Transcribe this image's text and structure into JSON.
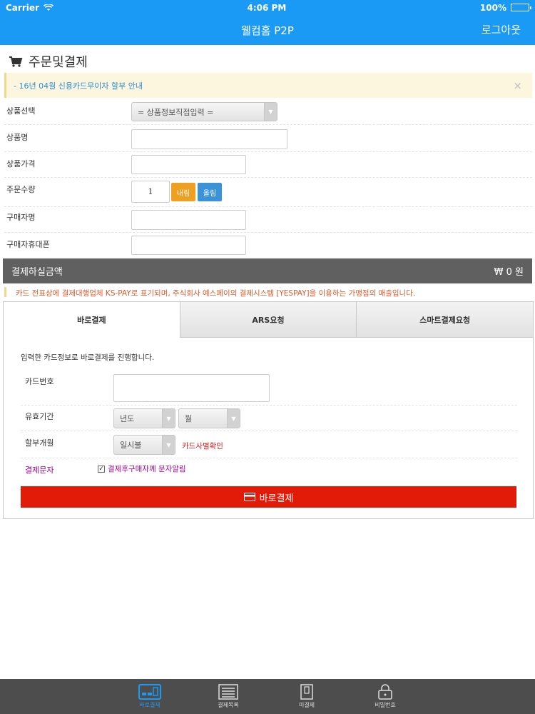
{
  "status": {
    "carrier": "Carrier",
    "time": "4:06 PM",
    "battery": "100%"
  },
  "nav": {
    "title": "웰컴홈 P2P",
    "logout": "로그아웃"
  },
  "page": {
    "title": "주문및결제"
  },
  "notice": {
    "text": "- 16년 04월 신용카드무이자 할부 안내",
    "close": "×"
  },
  "form": {
    "product_select_label": "상품선택",
    "product_select_value": "= 상품정보직접입력 =",
    "product_name_label": "상품명",
    "product_price_label": "상품가격",
    "quantity_label": "주문수량",
    "quantity_value": "1",
    "down_label": "내림",
    "up_label": "올림",
    "buyer_name_label": "구매자명",
    "buyer_phone_label": "구매자휴대폰"
  },
  "payment": {
    "label": "결제하실금액",
    "amount": "₩ 0 원"
  },
  "kspay_notice": "카드 전표상에 결제대행업체 KS-PAY로 표기되며, 주식회사 예스페이의 결제시스템 [YESPAY]을 이용하는 가맹점의 매출입니다.",
  "tabs": [
    {
      "label": "바로결제",
      "active": true
    },
    {
      "label": "ARS요청",
      "active": false
    },
    {
      "label": "스마트결제요청",
      "active": false
    }
  ],
  "direct": {
    "desc": "입력한 카드정보로 바로결제를 진행합니다.",
    "card_label": "카드번호",
    "expiry_label": "유효기간",
    "year_value": "년도",
    "month_value": "월",
    "installment_label": "할부개월",
    "installment_value": "일시불",
    "card_check_link": "카드사별확인",
    "sms_label": "결제문자",
    "sms_checkbox_label": "결제후구매자께 문자알림",
    "sms_checked": "✓",
    "pay_button": "바로결제"
  },
  "tabbar": [
    {
      "label": "바로결제",
      "icon": "card-reader-icon",
      "active": true
    },
    {
      "label": "결제목록",
      "icon": "list-icon",
      "active": false
    },
    {
      "label": "미결제",
      "icon": "document-icon",
      "active": false
    },
    {
      "label": "비밀번호",
      "icon": "lock-icon",
      "active": false
    }
  ],
  "colors": {
    "primary": "#1a9af5",
    "pay_button": "#e21a08",
    "dark_bar": "#606060",
    "warn": "#e05a2a"
  }
}
